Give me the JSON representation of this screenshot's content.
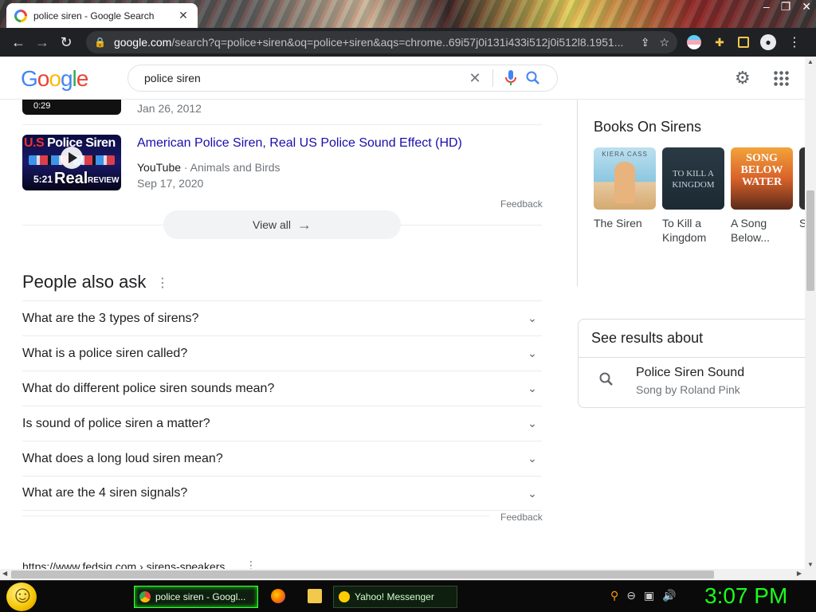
{
  "browser": {
    "tab_title": "police siren - Google Search",
    "url_host": "google.com",
    "url_path": "/search?q=police+siren&oq=police+siren&aqs=chrome..69i57j0i131i433i512j0i512l8.1951..."
  },
  "header": {
    "logo_letters": [
      "G",
      "o",
      "o",
      "g",
      "l",
      "e"
    ],
    "search_value": "police siren"
  },
  "videos": {
    "prev_duration": "0:29",
    "prev_date": "Jan 26, 2012",
    "item": {
      "thumb_title_us": "U.S",
      "thumb_title_rest": "Police Siren",
      "thumb_real": "Real",
      "thumb_review": "REVIEW",
      "duration": "5:21",
      "title": "American Police Siren, Real US Police Sound Effect (HD)",
      "source": "YouTube",
      "channel": " · Animals and Birds",
      "date": "Sep 17, 2020"
    },
    "feedback": "Feedback",
    "view_all": "View all"
  },
  "paa": {
    "title": "People also ask",
    "questions": [
      "What are the 3 types of sirens?",
      "What is a police siren called?",
      "What do different police siren sounds mean?",
      "Is sound of police siren a matter?",
      "What does a long loud siren mean?",
      "What are the 4 siren signals?"
    ],
    "feedback": "Feedback"
  },
  "next_result": {
    "cite": "https://www.fedsig.com › sirens-speakers"
  },
  "books": {
    "title": "Books On Sirens",
    "items": [
      {
        "label": "The Siren",
        "cover_text": "KIERA CASS"
      },
      {
        "label": "To Kill a Kingdom",
        "cover_text": "TO KILL A KINGDOM"
      },
      {
        "label": "A Song Below...",
        "cover_text": "SONG BELOW WATER"
      }
    ],
    "partial_label": "S"
  },
  "see_results": {
    "heading": "See results about",
    "title": "Police Siren Sound",
    "subtitle": "Song by Roland Pink"
  },
  "taskbar": {
    "chrome_task": "police siren - Googl...",
    "yahoo_task": "Yahoo! Messenger",
    "clock": "3:07 PM"
  },
  "colors": {
    "link": "#1a0dab",
    "clock": "#1aff1a",
    "chrome_dark": "#202124"
  }
}
